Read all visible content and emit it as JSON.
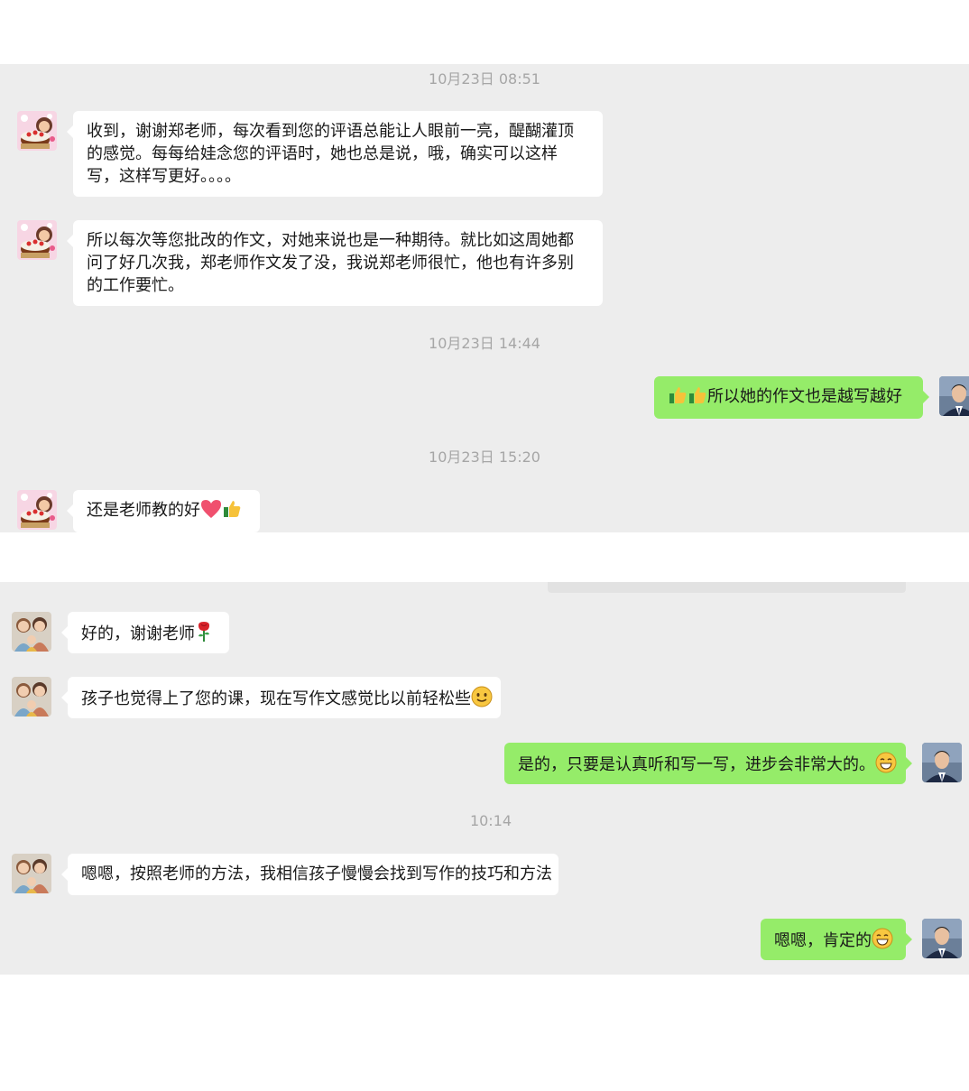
{
  "colors": {
    "chat_bg": "#ededed",
    "bubble_in": "#ffffff",
    "bubble_out": "#95ec69",
    "timestamp": "#a6a6a6"
  },
  "screen1": {
    "timestamps": [
      "10月23日 08:51",
      "10月23日 14:44",
      "10月23日 15:20"
    ],
    "messages": [
      {
        "side": "left",
        "avatar": "cake-girl-avatar",
        "text": "收到，谢谢郑老师，每次看到您的评语总能让人眼前一亮，醍醐灌顶的感觉。每每给娃念您的评语时，她也总是说，哦，确实可以这样写，这样写更好。。。。"
      },
      {
        "side": "left",
        "avatar": "cake-girl-avatar",
        "text": "所以每次等您批改的作文，对她来说也是一种期待。就比如这周她都问了好几次我，郑老师作文发了没，我说郑老师很忙，他也有许多别的工作要忙。"
      },
      {
        "side": "right",
        "avatar": "teacher-avatar",
        "emojis": [
          "thumbs-up-icon",
          "thumbs-up-icon"
        ],
        "text": "所以她的作文也是越写越好"
      },
      {
        "side": "left",
        "avatar": "cake-girl-avatar",
        "text": "还是老师教的好",
        "emojis": [
          "heart-icon",
          "thumbs-up-icon"
        ]
      }
    ]
  },
  "screen2": {
    "timestamps": [
      "10:14"
    ],
    "messages": [
      {
        "side": "left",
        "avatar": "family-avatar",
        "text": "好的，谢谢老师",
        "emojis": [
          "rose-icon"
        ]
      },
      {
        "side": "left",
        "avatar": "family-avatar",
        "text": "孩子也觉得上了您的课，现在写作文感觉比以前轻松些",
        "emojis": [
          "smile-icon"
        ]
      },
      {
        "side": "right",
        "avatar": "teacher-avatar",
        "text": "是的，只要是认真听和写一写，进步会非常大的。",
        "emojis": [
          "grin-icon"
        ]
      },
      {
        "side": "left",
        "avatar": "family-avatar",
        "text": "嗯嗯，按照老师的方法，我相信孩子慢慢会找到写作的技巧和方法"
      },
      {
        "side": "right",
        "avatar": "teacher-avatar",
        "text": "嗯嗯，肯定的",
        "emojis": [
          "grin-icon"
        ]
      }
    ]
  }
}
